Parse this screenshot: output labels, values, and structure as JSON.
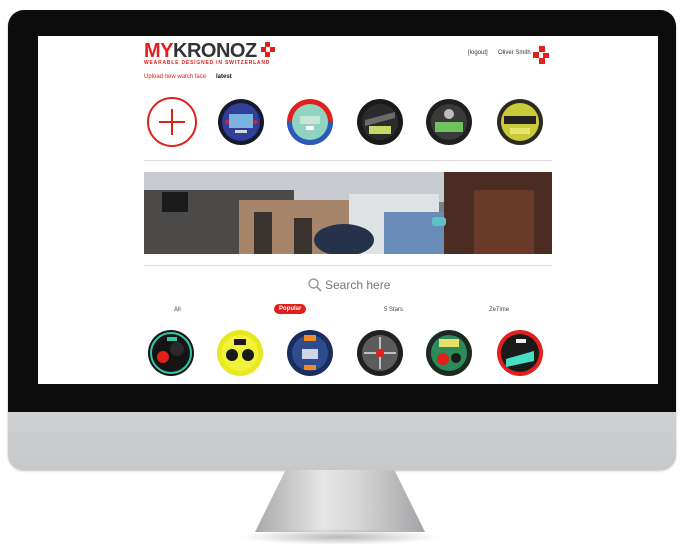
{
  "header": {
    "logo_main": "KRONOZ",
    "logo_prefix": "MY",
    "logo_tagline": "WEARABLE DESIGNED IN SWITZERLAND",
    "logout_label": "[logout]",
    "user_name": "Oliver Smith"
  },
  "nav": {
    "upload_label": "Upload new watch face",
    "latest_label": "latest"
  },
  "search": {
    "placeholder": "Search here"
  },
  "filters": {
    "all": "All",
    "popular": "Popular",
    "five_stars": "5 Stars",
    "zetime": "ZeTime"
  },
  "colors": {
    "brand_red": "#e1201b",
    "text": "#333333"
  },
  "icons": {
    "add": "plus-circle-icon",
    "search": "magnifier-icon",
    "brand": "kronoz-cross-icon"
  }
}
